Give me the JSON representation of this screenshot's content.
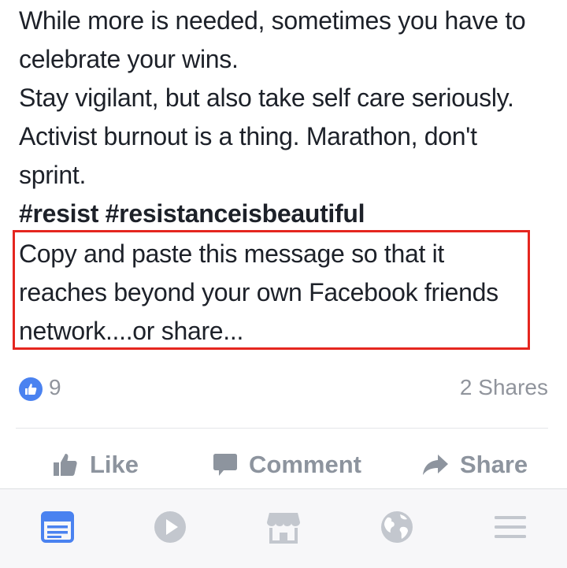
{
  "post": {
    "lines": [
      "While more is needed, sometimes you have to",
      "celebrate your wins.",
      "Stay vigilant, but also take self care seriously.",
      "Activist burnout is a thing. Marathon, don't",
      "sprint."
    ],
    "hashtags": "#resist #resistanceisbeautiful",
    "highlighted_lines": [
      "Copy and paste this message so that it",
      "reaches beyond your own Facebook friends",
      "network....or share..."
    ]
  },
  "stats": {
    "likes": "9",
    "shares": "2 Shares"
  },
  "actions": {
    "like_label": "Like",
    "comment_label": "Comment",
    "share_label": "Share"
  },
  "tabbar": {
    "icons": [
      "news-feed-icon",
      "video-icon",
      "marketplace-icon",
      "globe-icon",
      "menu-icon"
    ],
    "active": "news-feed-icon"
  },
  "colors": {
    "highlight_border": "#e5261f",
    "facebook_blue": "#4a82f0",
    "muted": "#8d949e",
    "text": "#1d2129"
  }
}
